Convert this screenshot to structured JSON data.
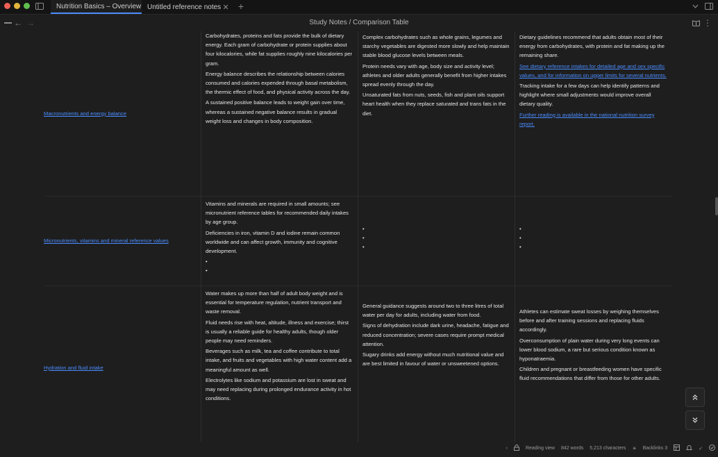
{
  "window": {
    "tabs": [
      {
        "title": "Nutrition Basics – Overview",
        "active": true
      },
      {
        "title": "Untitled reference notes",
        "active": false
      }
    ]
  },
  "nav": {
    "doc_title": "Study Notes / Comparison Table"
  },
  "table": {
    "rows": [
      {
        "label": "Macronutrients and energy balance",
        "col2": [
          "Carbohydrates, proteins and fats provide the bulk of dietary energy. Each gram of carbohydrate or protein supplies about four kilocalories, while fat supplies roughly nine kilocalories per gram.",
          "Energy balance describes the relationship between calories consumed and calories expended through basal metabolism, the thermic effect of food, and physical activity across the day.",
          "A sustained positive balance leads to weight gain over time, whereas a sustained negative balance results in gradual weight loss and changes in body composition."
        ],
        "col3": [
          "Complex carbohydrates such as whole grains, legumes and starchy vegetables are digested more slowly and help maintain stable blood glucose levels between meals.",
          "Protein needs vary with age, body size and activity level; athletes and older adults generally benefit from higher intakes spread evenly through the day.",
          "Unsaturated fats from nuts, seeds, fish and plant oils support heart health when they replace saturated and trans fats in the diet."
        ],
        "col4": [
          "Dietary guidelines recommend that adults obtain most of their energy from carbohydrates, with protein and fat making up the remaining share.",
          "See dietary reference intakes for detailed age and sex specific values, and for information on upper limits for several nutrients.",
          "Tracking intake for a few days can help identify patterns and highlight where small adjustments would improve overall dietary quality.",
          "Further reading is available in the national nutrition survey report."
        ]
      },
      {
        "label": "Micronutrients, vitamins and mineral reference values",
        "col2": [
          "Vitamins and minerals are required in small amounts; see micronutrient reference tables for recommended daily intakes by age group.",
          "Deficiencies in iron, vitamin D and iodine remain common worldwide and can affect growth, immunity and cognitive development.",
          "•",
          "•"
        ],
        "col3": [
          "•",
          "•",
          "•"
        ],
        "col4": [
          "•",
          "•",
          "•"
        ]
      },
      {
        "label": "Hydration and fluid intake",
        "col2": [
          "Water makes up more than half of adult body weight and is essential for temperature regulation, nutrient transport and waste removal.",
          "Fluid needs rise with heat, altitude, illness and exercise; thirst is usually a reliable guide for healthy adults, though older people may need reminders.",
          "Beverages such as milk, tea and coffee contribute to total intake, and fruits and vegetables with high water content add a meaningful amount as well.",
          "Electrolytes like sodium and potassium are lost in sweat and may need replacing during prolonged endurance activity in hot conditions."
        ],
        "col3": [
          "General guidance suggests around two to three litres of total water per day for adults, including water from food.",
          "Signs of dehydration include dark urine, headache, fatigue and reduced concentration; severe cases require prompt medical attention.",
          "Sugary drinks add energy without much nutritional value and are best limited in favour of water or unsweetened options."
        ],
        "col4": [
          "Athletes can estimate sweat losses by weighing themselves before and after training sessions and replacing fluids accordingly.",
          "Overconsumption of plain water during very long events can lower blood sodium, a rare but serious condition known as hyponatraemia.",
          "Children and pregnant or breastfeeding women have specific fluid recommendations that differ from those for other adults."
        ]
      }
    ]
  },
  "status": {
    "items": [
      "Reading view",
      "842 words",
      "5,213 characters",
      "Backlinks 3"
    ]
  }
}
